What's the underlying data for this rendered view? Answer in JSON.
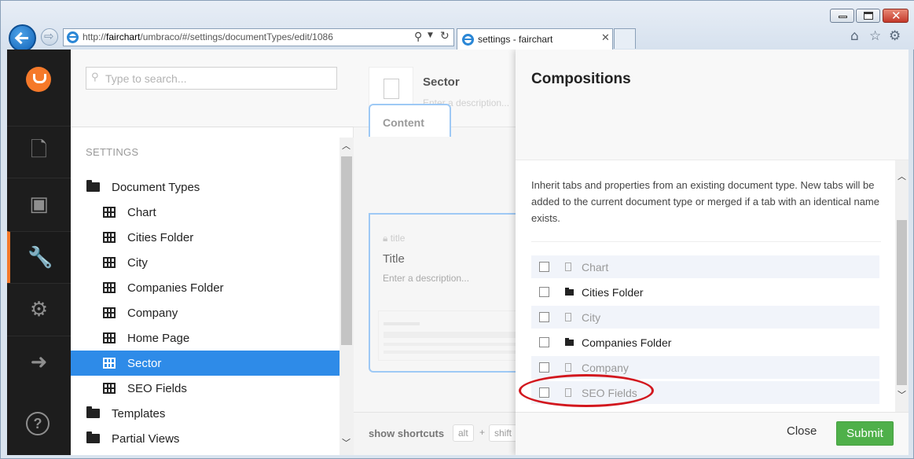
{
  "browser": {
    "address_prefix": "http://",
    "address_host": "fairchart",
    "address_path": "/umbraco/#/settings/documentTypes/edit/1086",
    "tab_title": "settings - fairchart"
  },
  "search": {
    "placeholder": "Type to search..."
  },
  "tree": {
    "section_label": "SETTINGS",
    "items": [
      {
        "label": "Document Types",
        "kind": "folder"
      },
      {
        "label": "Chart",
        "kind": "doctype"
      },
      {
        "label": "Cities Folder",
        "kind": "doctype"
      },
      {
        "label": "City",
        "kind": "doctype"
      },
      {
        "label": "Companies Folder",
        "kind": "doctype"
      },
      {
        "label": "Company",
        "kind": "doctype"
      },
      {
        "label": "Home Page",
        "kind": "doctype"
      },
      {
        "label": "Sector",
        "kind": "doctype",
        "selected": true
      },
      {
        "label": "SEO Fields",
        "kind": "doctype"
      },
      {
        "label": "Templates",
        "kind": "folder"
      },
      {
        "label": "Partial Views",
        "kind": "folder"
      }
    ]
  },
  "editor": {
    "name": "Sector",
    "description_placeholder": "Enter a description...",
    "tab_label": "Content",
    "property_alias": "title",
    "property_name": "Title",
    "property_description": "Enter a description...",
    "shortcuts_label": "show shortcuts",
    "key_alt": "alt",
    "key_plus": "+",
    "key_shift": "shift"
  },
  "compositions": {
    "title": "Compositions",
    "intro": "Inherit tabs and properties from an existing document type. New tabs will be added to the current document type or merged if a tab with an identical name exists.",
    "items": [
      {
        "label": "Chart",
        "enabled": false,
        "icon": "document-icon"
      },
      {
        "label": "Cities Folder",
        "enabled": true,
        "icon": "folder-icon"
      },
      {
        "label": "City",
        "enabled": false,
        "icon": "document-icon"
      },
      {
        "label": "Companies Folder",
        "enabled": true,
        "icon": "folder-icon"
      },
      {
        "label": "Company",
        "enabled": false,
        "icon": "document-icon"
      },
      {
        "label": "SEO Fields",
        "enabled": false,
        "icon": "document-icon"
      }
    ],
    "close_label": "Close",
    "submit_label": "Submit"
  },
  "colors": {
    "accent_orange": "#f5792a",
    "selected_blue": "#2e8be8",
    "submit_green": "#4fb04a",
    "annotation_red": "#d2171e"
  }
}
